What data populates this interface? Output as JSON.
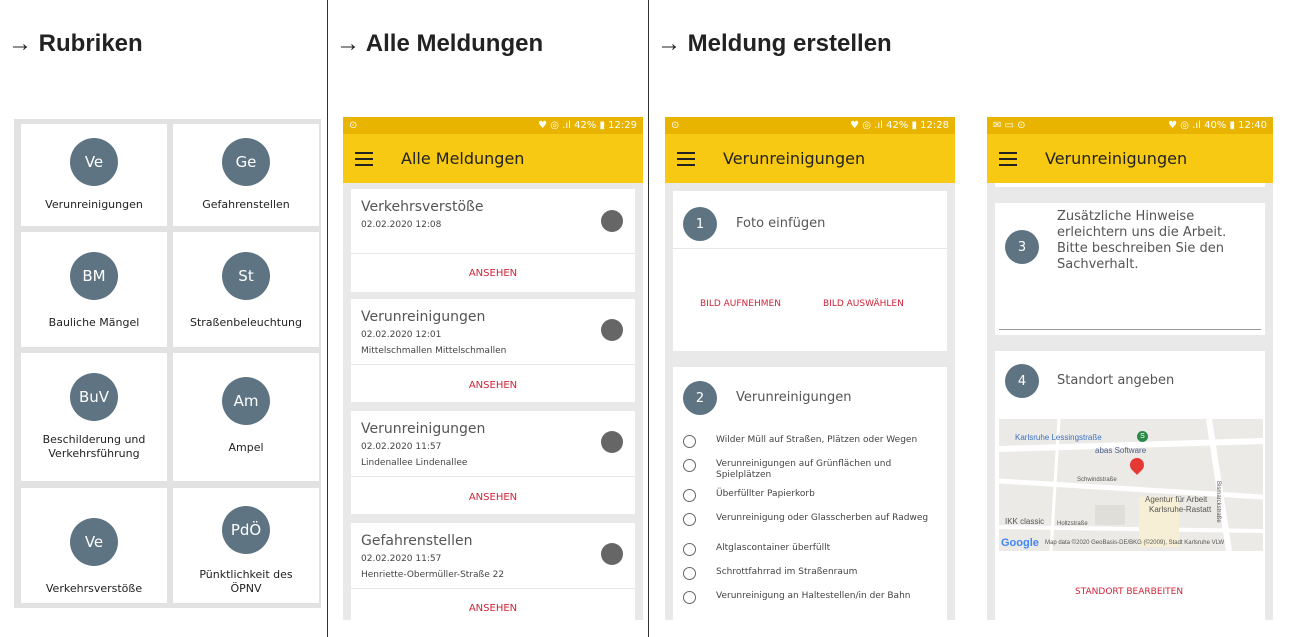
{
  "columns": {
    "rubriken": "→ Rubriken",
    "alle": "→ Alle Meldungen",
    "erstellen": "→ Meldung erstellen"
  },
  "status": {
    "p1": "⊙",
    "p1_right": "♥ ◎ .ıl 42% ▮ 12:29",
    "p2": "⊙",
    "p2_right": "♥ ◎ .ıl 42% ▮ 12:28",
    "p3": "✉ ▭ ⊙",
    "p3_right": "♥ ◎ .ıl 40% ▮ 12:40"
  },
  "rubriken": [
    {
      "abbr": "Ve",
      "label": "Verunreinigungen"
    },
    {
      "abbr": "Ge",
      "label": "Gefahrenstellen"
    },
    {
      "abbr": "BM",
      "label": "Bauliche Mängel"
    },
    {
      "abbr": "St",
      "label": "Straßenbeleuchtung"
    },
    {
      "abbr": "BuV",
      "label": "Beschilderung und Verkehrsführung"
    },
    {
      "abbr": "Am",
      "label": "Ampel"
    },
    {
      "abbr": "Ve",
      "label": "Verkehrsverstöße"
    },
    {
      "abbr": "PdÖ",
      "label": "Pünktlichkeit des ÖPNV"
    }
  ],
  "alle": {
    "title": "Alle Meldungen",
    "cards": [
      {
        "title": "Verkehrsverstöße",
        "date": "02.02.2020 12:08",
        "addr": "",
        "action": "ANSEHEN"
      },
      {
        "title": "Verunreinigungen",
        "date": "02.02.2020 12:01",
        "addr": "Mittelschmallen Mittelschmallen",
        "action": "ANSEHEN"
      },
      {
        "title": "Verunreinigungen",
        "date": "02.02.2020 11:57",
        "addr": "Lindenallee Lindenallee",
        "action": "ANSEHEN"
      },
      {
        "title": "Gefahrenstellen",
        "date": "02.02.2020 11:57",
        "addr": "Henriette-Obermüller-Straße 22",
        "action": "ANSEHEN"
      }
    ]
  },
  "erstellen": {
    "title": "Verunreinigungen",
    "step1": {
      "num": "1",
      "label": "Foto einfügen",
      "take": "BILD AUFNEHMEN",
      "choose": "BILD AUSWÄHLEN"
    },
    "step2": {
      "num": "2",
      "label": "Verunreinigungen"
    },
    "options": [
      "Wilder Müll auf Straßen, Plätzen oder Wegen",
      "Verunreinigungen auf Grünflächen und Spielplätzen",
      "Überfüllter Papierkorb",
      "Verunreinigung oder Glasscherben auf Radweg",
      "Altglascontainer überfüllt",
      "Schrottfahrrad im Straßenraum",
      "Verunreinigung an Haltestellen/in der Bahn"
    ],
    "step3": {
      "num": "3",
      "label": "Zusätzliche Hinweise erleichtern uns die Arbeit. Bitte beschreiben Sie den Sachverhalt."
    },
    "step4": {
      "num": "4",
      "label": "Standort angeben",
      "action": "STANDORT BEARBEITEN"
    },
    "map": {
      "station": "Karlsruhe Lessingstraße",
      "company": "abas Software",
      "street1": "Schwindstraße",
      "agency1": "Agentur für Arbeit",
      "agency2": "Karlsruhe-Rastatt",
      "ikk": "IKK classic",
      "street2": "Holtzstraße",
      "street3": "Bismarckstraße",
      "google": "Google",
      "attribution": "Map data ©2020 GeoBasis-DE/BKG (©2009), Stadt Karlsruhe VLW"
    }
  }
}
